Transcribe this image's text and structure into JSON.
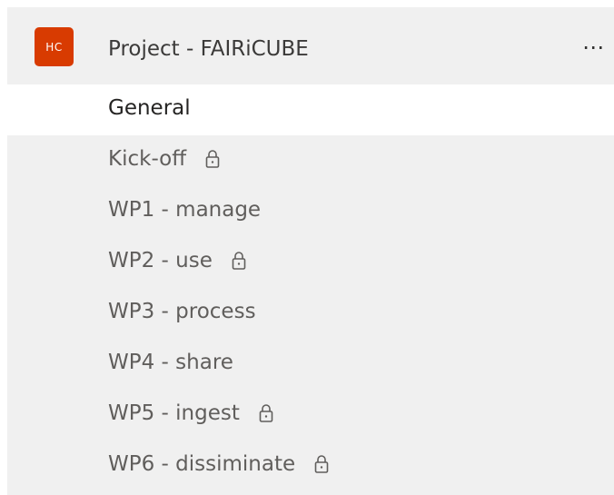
{
  "team": {
    "avatar_initials": "HC",
    "avatar_color": "#d83b01",
    "name": "Project - FAIRiCUBE",
    "more_label": "⋯"
  },
  "channels": [
    {
      "label": "General",
      "locked": false,
      "selected": true
    },
    {
      "label": "Kick-off",
      "locked": true,
      "selected": false
    },
    {
      "label": "WP1 - manage",
      "locked": false,
      "selected": false
    },
    {
      "label": "WP2 - use",
      "locked": true,
      "selected": false
    },
    {
      "label": "WP3 - process",
      "locked": false,
      "selected": false
    },
    {
      "label": "WP4 - share",
      "locked": false,
      "selected": false
    },
    {
      "label": "WP5 - ingest",
      "locked": true,
      "selected": false
    },
    {
      "label": "WP6 - dissiminate",
      "locked": true,
      "selected": false
    }
  ],
  "icons": {
    "lock": "lock-icon",
    "more": "more-options-icon"
  }
}
